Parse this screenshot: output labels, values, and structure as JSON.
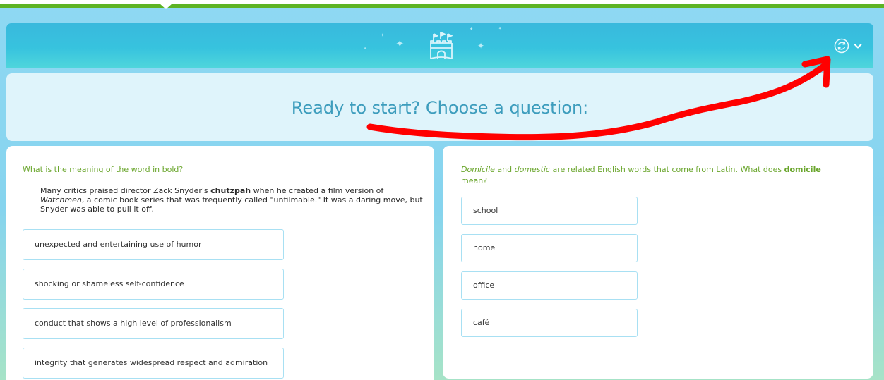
{
  "header": {
    "logo_icon": "castle-icon",
    "menu_icon": "sync-icon",
    "dropdown_icon": "chevron-down-icon"
  },
  "banner": {
    "title": "Ready to start? Choose a question:"
  },
  "left_question": {
    "prompt": "What is the meaning of the word in bold?",
    "passage_parts": {
      "p1": "Many critics praised director Zack Snyder's ",
      "bold_word": "chutzpah",
      "p2": " when he created a film version of ",
      "italic_title": "Watchmen",
      "p3": ", a comic book series that was frequently called \"unfilmable.\" It was a daring move, but Snyder was able to pull it off."
    },
    "options": [
      "unexpected and entertaining use of humor",
      "shocking or shameless self-confidence",
      "conduct that shows a high level of professionalism",
      "integrity that generates widespread respect and admiration"
    ]
  },
  "right_question": {
    "prompt_parts": {
      "italic1": "Domicile",
      "and": " and ",
      "italic2": "domestic",
      "middle": " are related English words that come from Latin. What does ",
      "bold_word": "domicile",
      "end": " mean?"
    },
    "options": [
      "school",
      "home",
      "office",
      "café"
    ]
  },
  "colors": {
    "top_bar_green": "#5db324",
    "header_teal": "#39b9dd",
    "banner_text": "#3d9dbd",
    "question_green": "#69a52b",
    "option_border": "#a8e0f3",
    "annotation_red": "#ff0000"
  }
}
